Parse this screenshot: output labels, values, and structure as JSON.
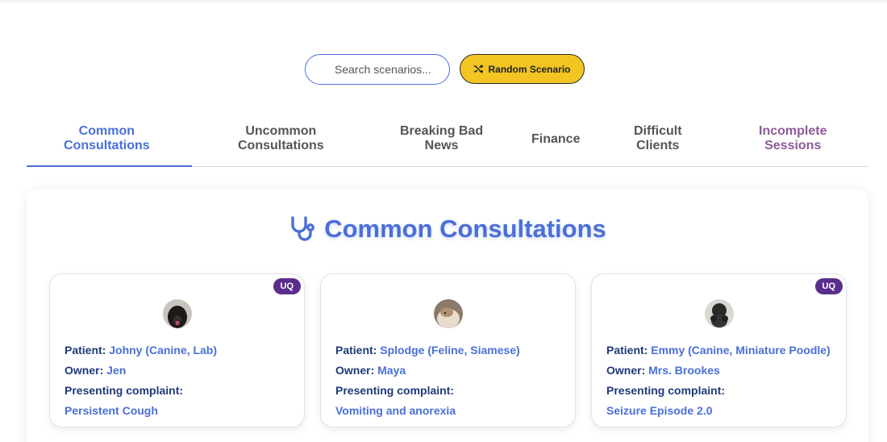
{
  "search": {
    "placeholder": "Search scenarios..."
  },
  "random_button": {
    "label": "Random Scenario",
    "icon": "shuffle-icon"
  },
  "tabs": [
    {
      "line1": "Common",
      "line2": "Consultations"
    },
    {
      "line1": "Uncommon",
      "line2": "Consultations"
    },
    {
      "line1": "Breaking Bad",
      "line2": "News"
    },
    {
      "line1": "Finance",
      "line2": ""
    },
    {
      "line1": "Difficult",
      "line2": "Clients"
    },
    {
      "line1": "Incomplete",
      "line2": "Sessions"
    }
  ],
  "section": {
    "title": "Common Consultations",
    "icon": "stethoscope-icon"
  },
  "labels": {
    "patient": "Patient:",
    "owner": "Owner:",
    "complaint": "Presenting complaint:"
  },
  "cards": [
    {
      "badge": "UQ",
      "patient": "Johny (Canine, Lab)",
      "owner": "Jen",
      "complaint": "Persistent Cough"
    },
    {
      "badge": "",
      "patient": "Splodge (Feline, Siamese)",
      "owner": "Maya",
      "complaint": "Vomiting and anorexia"
    },
    {
      "badge": "UQ",
      "patient": "Emmy (Canine, Miniature Poodle)",
      "owner": "Mrs. Brookes",
      "complaint": "Seizure Episode 2.0"
    }
  ],
  "colors": {
    "accent": "#4a6fd8",
    "button": "#f2c523",
    "badge": "#5a2d8c",
    "incomplete": "#8e5a9c"
  }
}
